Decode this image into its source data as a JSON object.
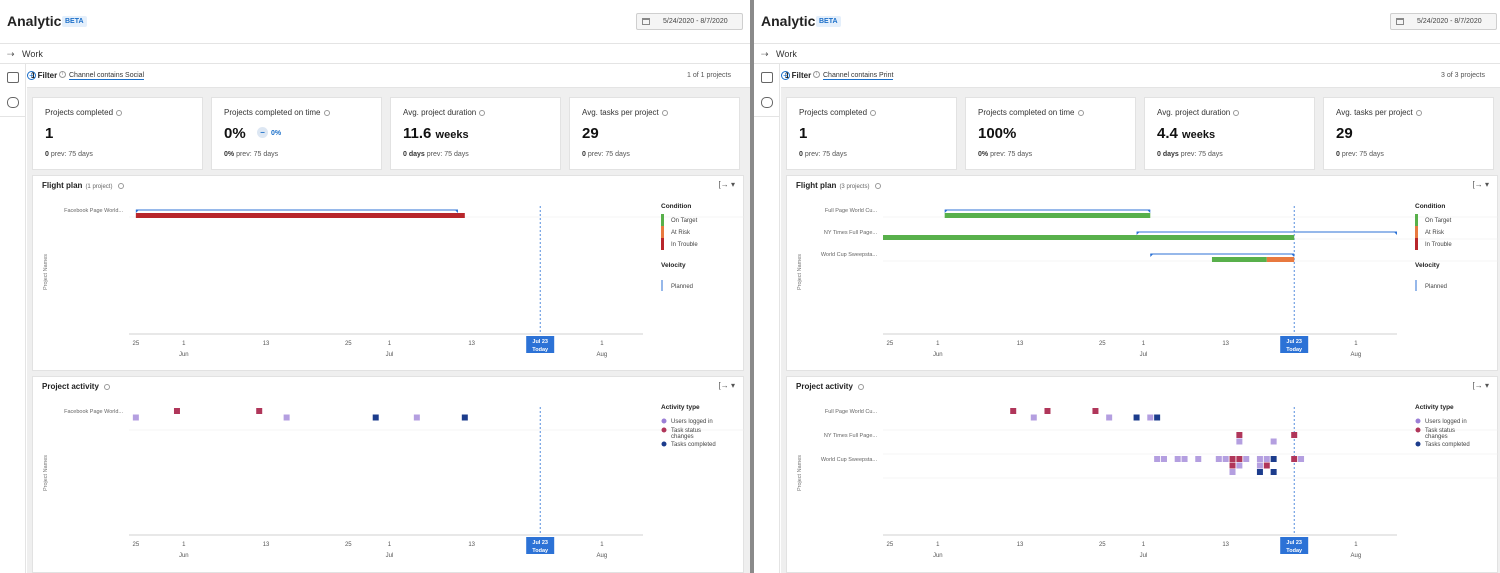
{
  "panels": [
    {
      "title": "Analytics",
      "badge": "BETA",
      "date_range": "5/24/2020 - 8/7/2020",
      "work_label": "Work",
      "filter_count": "1 Filter",
      "filter_chip": "Channel contains Social",
      "projects_shown": "1 of 1 projects",
      "cards": [
        {
          "label": "Projects completed",
          "value": "1",
          "unit": "",
          "delta": "",
          "prev_value": "0",
          "prev_text": "prev: 75 days"
        },
        {
          "label": "Projects completed on time",
          "value": "0%",
          "unit": "",
          "delta": "0%",
          "prev_value": "0%",
          "prev_text": "prev: 75 days"
        },
        {
          "label": "Avg. project duration",
          "value": "11.6",
          "unit": "weeks",
          "delta": "",
          "prev_value": "0 days",
          "prev_text": "prev: 75 days"
        },
        {
          "label": "Avg. tasks per project",
          "value": "29",
          "unit": "",
          "delta": "",
          "prev_value": "0",
          "prev_text": "prev: 75 days"
        }
      ],
      "flight_plan": {
        "title": "Flight plan",
        "subtitle": "(1 project)"
      },
      "project_activity": {
        "title": "Project activity"
      }
    },
    {
      "title": "Analytics",
      "badge": "BETA",
      "date_range": "5/24/2020 - 8/7/2020",
      "work_label": "Work",
      "filter_count": "1 Filter",
      "filter_chip": "Channel contains Print",
      "projects_shown": "3 of 3 projects",
      "cards": [
        {
          "label": "Projects completed",
          "value": "1",
          "unit": "",
          "delta": "",
          "prev_value": "0",
          "prev_text": "prev: 75 days"
        },
        {
          "label": "Projects completed on time",
          "value": "100%",
          "unit": "",
          "delta": "",
          "prev_value": "0%",
          "prev_text": "prev: 75 days"
        },
        {
          "label": "Avg. project duration",
          "value": "4.4",
          "unit": "weeks",
          "delta": "",
          "prev_value": "0 days",
          "prev_text": "prev: 75 days"
        },
        {
          "label": "Avg. tasks per project",
          "value": "29",
          "unit": "",
          "delta": "",
          "prev_value": "0",
          "prev_text": "prev: 75 days"
        }
      ],
      "flight_plan": {
        "title": "Flight plan",
        "subtitle": "(3 projects)"
      },
      "project_activity": {
        "title": "Project activity"
      }
    }
  ],
  "colors": {
    "on_target": "#58b04b",
    "at_risk": "#e8793f",
    "in_trouble": "#b8262b",
    "planned": "#2c72d6",
    "users_logged_in": "#9b7fd6",
    "task_status_changes": "#b0365a",
    "tasks_completed": "#1c3c8c"
  },
  "chart_data": [
    {
      "type": "gantt",
      "title": "Flight plan",
      "ylabel": "Project Names",
      "x_ticks": [
        {
          "label": "25",
          "month": "",
          "date": "2020-05-25"
        },
        {
          "label": "1",
          "month": "Jun",
          "date": "2020-06-01"
        },
        {
          "label": "13",
          "month": "",
          "date": "2020-06-13"
        },
        {
          "label": "25",
          "month": "",
          "date": "2020-06-25"
        },
        {
          "label": "1",
          "month": "Jul",
          "date": "2020-07-01"
        },
        {
          "label": "13",
          "month": "",
          "date": "2020-07-13"
        },
        {
          "label": "1",
          "month": "Aug",
          "date": "2020-08-01"
        }
      ],
      "xlim": [
        "2020-05-24",
        "2020-08-07"
      ],
      "today": {
        "date": "2020-07-23",
        "label1": "Jul 23",
        "label2": "Today"
      },
      "legend": {
        "condition_title": "Condition",
        "condition": [
          "On Target",
          "At Risk",
          "In Trouble"
        ],
        "velocity_title": "Velocity",
        "velocity": [
          "Planned"
        ]
      },
      "projects": [
        {
          "name": "Facebook Page World...",
          "planned": [
            "2020-05-25",
            "2020-07-11"
          ],
          "actual": [
            {
              "start": "2020-05-25",
              "end": "2020-07-12",
              "condition": "In Trouble"
            }
          ]
        }
      ]
    },
    {
      "type": "scatter",
      "title": "Project activity",
      "ylabel": "Project Names",
      "x_ticks": [
        {
          "label": "25",
          "month": "",
          "date": "2020-05-25"
        },
        {
          "label": "1",
          "month": "Jun",
          "date": "2020-06-01"
        },
        {
          "label": "13",
          "month": "",
          "date": "2020-06-13"
        },
        {
          "label": "25",
          "month": "",
          "date": "2020-06-25"
        },
        {
          "label": "1",
          "month": "Jul",
          "date": "2020-07-01"
        },
        {
          "label": "13",
          "month": "",
          "date": "2020-07-13"
        },
        {
          "label": "1",
          "month": "Aug",
          "date": "2020-08-01"
        }
      ],
      "xlim": [
        "2020-05-24",
        "2020-08-07"
      ],
      "today": {
        "date": "2020-07-23",
        "label1": "Jul 23",
        "label2": "Today"
      },
      "legend": {
        "title": "Activity type",
        "items": [
          "Users logged in",
          "Task status changes",
          "Tasks completed"
        ]
      },
      "projects": [
        "Facebook Page World..."
      ],
      "points": [
        {
          "project": 0,
          "date": "2020-05-25",
          "type": "Users logged in",
          "row": 1
        },
        {
          "project": 0,
          "date": "2020-05-31",
          "type": "Task status changes",
          "row": 0
        },
        {
          "project": 0,
          "date": "2020-06-12",
          "type": "Task status changes",
          "row": 0
        },
        {
          "project": 0,
          "date": "2020-06-16",
          "type": "Users logged in",
          "row": 1
        },
        {
          "project": 0,
          "date": "2020-06-29",
          "type": "Tasks completed",
          "row": 1
        },
        {
          "project": 0,
          "date": "2020-07-05",
          "type": "Users logged in",
          "row": 1
        },
        {
          "project": 0,
          "date": "2020-07-12",
          "type": "Tasks completed",
          "row": 1
        }
      ]
    },
    {
      "type": "gantt",
      "title": "Flight plan",
      "ylabel": "Project Names",
      "x_ticks": [
        {
          "label": "25",
          "month": "",
          "date": "2020-05-25"
        },
        {
          "label": "1",
          "month": "Jun",
          "date": "2020-06-01"
        },
        {
          "label": "13",
          "month": "",
          "date": "2020-06-13"
        },
        {
          "label": "25",
          "month": "",
          "date": "2020-06-25"
        },
        {
          "label": "1",
          "month": "Jul",
          "date": "2020-07-01"
        },
        {
          "label": "13",
          "month": "",
          "date": "2020-07-13"
        },
        {
          "label": "1",
          "month": "Aug",
          "date": "2020-08-01"
        }
      ],
      "xlim": [
        "2020-05-24",
        "2020-08-07"
      ],
      "today": {
        "date": "2020-07-23",
        "label1": "Jul 23",
        "label2": "Today"
      },
      "legend": {
        "condition_title": "Condition",
        "condition": [
          "On Target",
          "At Risk",
          "In Trouble"
        ],
        "velocity_title": "Velocity",
        "velocity": [
          "Planned"
        ]
      },
      "projects": [
        {
          "name": "Full Page World Cu...",
          "planned": [
            "2020-06-02",
            "2020-07-02"
          ],
          "actual": [
            {
              "start": "2020-06-02",
              "end": "2020-07-02",
              "condition": "On Target"
            }
          ]
        },
        {
          "name": "NY Times Full Page...",
          "planned": [
            "2020-06-30",
            "2020-08-07"
          ],
          "actual": [
            {
              "start": "2020-05-24",
              "end": "2020-07-23",
              "condition": "On Target"
            }
          ]
        },
        {
          "name": "World Cup Sweepsta...",
          "planned": [
            "2020-07-02",
            "2020-07-23"
          ],
          "actual": [
            {
              "start": "2020-07-11",
              "end": "2020-07-19",
              "condition": "On Target"
            },
            {
              "start": "2020-07-19",
              "end": "2020-07-23",
              "condition": "At Risk"
            }
          ]
        }
      ]
    },
    {
      "type": "scatter",
      "title": "Project activity",
      "ylabel": "Project Names",
      "x_ticks": [
        {
          "label": "25",
          "month": "",
          "date": "2020-05-25"
        },
        {
          "label": "1",
          "month": "Jun",
          "date": "2020-06-01"
        },
        {
          "label": "13",
          "month": "",
          "date": "2020-06-13"
        },
        {
          "label": "25",
          "month": "",
          "date": "2020-06-25"
        },
        {
          "label": "1",
          "month": "Jul",
          "date": "2020-07-01"
        },
        {
          "label": "13",
          "month": "",
          "date": "2020-07-13"
        },
        {
          "label": "1",
          "month": "Aug",
          "date": "2020-08-01"
        }
      ],
      "xlim": [
        "2020-05-24",
        "2020-08-07"
      ],
      "today": {
        "date": "2020-07-23",
        "label1": "Jul 23",
        "label2": "Today"
      },
      "legend": {
        "title": "Activity type",
        "items": [
          "Users logged in",
          "Task status changes",
          "Tasks completed"
        ]
      },
      "projects": [
        "Full Page World Cu...",
        "NY Times Full Page...",
        "World Cup Sweepsta..."
      ],
      "points": [
        {
          "project": 0,
          "date": "2020-06-12",
          "type": "Task status changes",
          "row": 0
        },
        {
          "project": 0,
          "date": "2020-06-15",
          "type": "Users logged in",
          "row": 1
        },
        {
          "project": 0,
          "date": "2020-06-17",
          "type": "Task status changes",
          "row": 0
        },
        {
          "project": 0,
          "date": "2020-06-24",
          "type": "Task status changes",
          "row": 0
        },
        {
          "project": 0,
          "date": "2020-06-26",
          "type": "Users logged in",
          "row": 1
        },
        {
          "project": 0,
          "date": "2020-06-30",
          "type": "Tasks completed",
          "row": 1
        },
        {
          "project": 0,
          "date": "2020-07-02",
          "type": "Users logged in",
          "row": 1
        },
        {
          "project": 0,
          "date": "2020-07-03",
          "type": "Tasks completed",
          "row": 1
        },
        {
          "project": 1,
          "date": "2020-07-15",
          "type": "Task status changes",
          "row": 0
        },
        {
          "project": 1,
          "date": "2020-07-23",
          "type": "Task status changes",
          "row": 0
        },
        {
          "project": 1,
          "date": "2020-07-15",
          "type": "Users logged in",
          "row": 1
        },
        {
          "project": 1,
          "date": "2020-07-20",
          "type": "Users logged in",
          "row": 1
        },
        {
          "project": 2,
          "date": "2020-07-03",
          "type": "Users logged in",
          "row": 0
        },
        {
          "project": 2,
          "date": "2020-07-04",
          "type": "Users logged in",
          "row": 0
        },
        {
          "project": 2,
          "date": "2020-07-06",
          "type": "Users logged in",
          "row": 0
        },
        {
          "project": 2,
          "date": "2020-07-07",
          "type": "Users logged in",
          "row": 0
        },
        {
          "project": 2,
          "date": "2020-07-09",
          "type": "Users logged in",
          "row": 0
        },
        {
          "project": 2,
          "date": "2020-07-12",
          "type": "Users logged in",
          "row": 0
        },
        {
          "project": 2,
          "date": "2020-07-13",
          "type": "Users logged in",
          "row": 0
        },
        {
          "project": 2,
          "date": "2020-07-14",
          "type": "Task status changes",
          "row": 0
        },
        {
          "project": 2,
          "date": "2020-07-15",
          "type": "Task status changes",
          "row": 0
        },
        {
          "project": 2,
          "date": "2020-07-16",
          "type": "Users logged in",
          "row": 0
        },
        {
          "project": 2,
          "date": "2020-07-18",
          "type": "Users logged in",
          "row": 0
        },
        {
          "project": 2,
          "date": "2020-07-19",
          "type": "Users logged in",
          "row": 0
        },
        {
          "project": 2,
          "date": "2020-07-20",
          "type": "Tasks completed",
          "row": 0
        },
        {
          "project": 2,
          "date": "2020-07-23",
          "type": "Task status changes",
          "row": 0
        },
        {
          "project": 2,
          "date": "2020-07-24",
          "type": "Users logged in",
          "row": 0
        },
        {
          "project": 2,
          "date": "2020-07-14",
          "type": "Task status changes",
          "row": 1
        },
        {
          "project": 2,
          "date": "2020-07-15",
          "type": "Users logged in",
          "row": 1
        },
        {
          "project": 2,
          "date": "2020-07-18",
          "type": "Users logged in",
          "row": 1
        },
        {
          "project": 2,
          "date": "2020-07-19",
          "type": "Task status changes",
          "row": 1
        },
        {
          "project": 2,
          "date": "2020-07-14",
          "type": "Users logged in",
          "row": 2
        },
        {
          "project": 2,
          "date": "2020-07-18",
          "type": "Tasks completed",
          "row": 2
        },
        {
          "project": 2,
          "date": "2020-07-20",
          "type": "Tasks completed",
          "row": 2
        }
      ]
    }
  ]
}
